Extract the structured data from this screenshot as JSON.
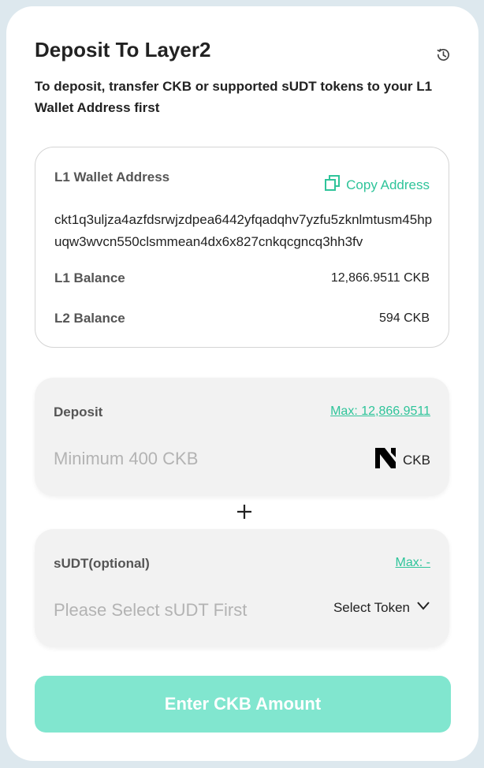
{
  "header": {
    "title": "Deposit To Layer2",
    "history_icon": "clock-history-icon",
    "description": "To deposit, transfer CKB or supported sUDT tokens to your L1 Wallet Address first"
  },
  "wallet": {
    "label": "L1 Wallet Address",
    "copy_label": "Copy Address",
    "copy_icon": "copy-icon",
    "address": "ckt1q3uljza4azfdsrwjzdpea6442yfqadqhv7yzfu5zknlmtusm45hpuqw3wvcn550clsmmean4dx6x827cnkqcgncq3hh3fv",
    "l1_balance_label": "L1 Balance",
    "l1_balance_value": "12,866.9511 CKB",
    "l2_balance_label": "L2 Balance",
    "l2_balance_value": "594 CKB"
  },
  "deposit": {
    "label": "Deposit",
    "max_label": "Max: 12,866.9511",
    "placeholder": "Minimum 400 CKB",
    "token_icon": "nervos-logo-icon",
    "token_label": "CKB"
  },
  "separator": {
    "icon": "plus-icon"
  },
  "sudt": {
    "label": "sUDT(optional)",
    "max_label": "Max: -",
    "placeholder": "Please Select sUDT First",
    "select_label": "Select Token",
    "chevron_icon": "chevron-down-icon"
  },
  "submit": {
    "label": "Enter CKB Amount"
  },
  "colors": {
    "accent": "#2fc49a",
    "button": "#81e6cf",
    "panel": "#f2f2f2",
    "background": "#dde8ee"
  }
}
